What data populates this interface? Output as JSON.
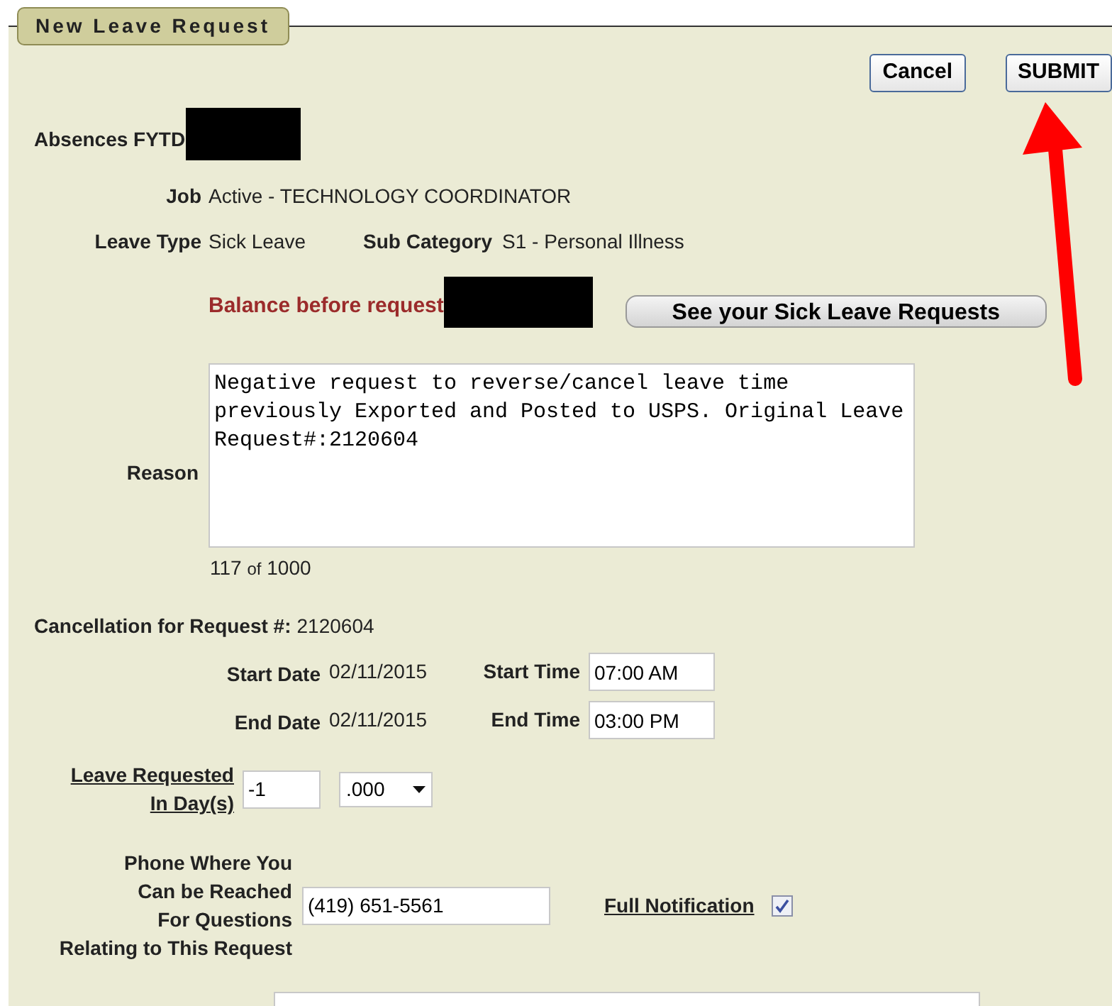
{
  "panel": {
    "legend": "New Leave Request"
  },
  "buttons": [
    {
      "label": "Cancel"
    },
    {
      "label": "SUBMIT"
    }
  ],
  "absences": {
    "label": "Absences FYTD"
  },
  "job": {
    "label": "Job",
    "value": "Active - TECHNOLOGY COORDINATOR"
  },
  "leave_type": {
    "label": "Leave Type",
    "value": "Sick Leave"
  },
  "sub_category": {
    "label": "Sub Category",
    "value": "S1 - Personal Illness"
  },
  "balance": {
    "label": "Balance before request",
    "requests_button": "See your Sick Leave Requests"
  },
  "reason": {
    "label": "Reason",
    "value": "Negative request to reverse/cancel leave time previously Exported and Posted to USPS. Original Leave Request#:2120604",
    "count": "117",
    "of": "of",
    "max": "1000"
  },
  "cancellation": {
    "label": "Cancellation for Request #:",
    "value": "2120604"
  },
  "start": {
    "date_label": "Start Date",
    "date": "02/11/2015",
    "time_label": "Start Time",
    "time": "07:00 AM"
  },
  "end": {
    "date_label": "End Date",
    "date": "02/11/2015",
    "time_label": "End Time",
    "time": "03:00 PM"
  },
  "leave_requested": {
    "label_lines": [
      "Leave Requested",
      "In Day(s)"
    ],
    "days": "-1",
    "fraction": ".000"
  },
  "phone": {
    "label_lines": [
      "Phone Where You",
      "Can be Reached",
      "For Questions",
      "Relating to This Request"
    ],
    "value": "(419) 651-5561"
  },
  "full_notification": {
    "label": "Full Notification",
    "checked": true
  }
}
